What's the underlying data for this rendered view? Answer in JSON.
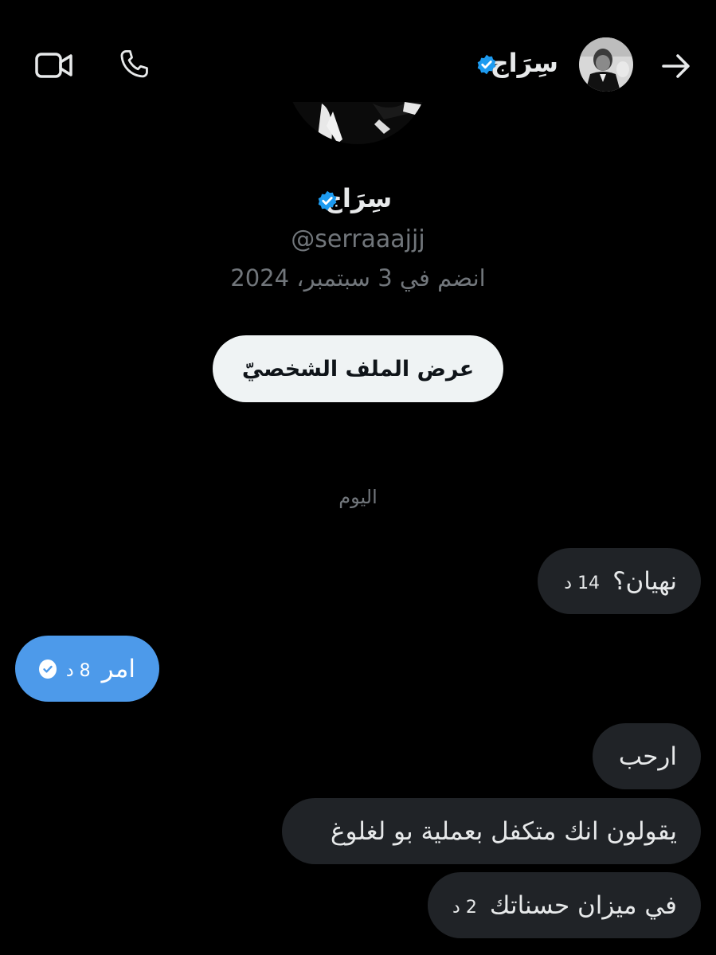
{
  "header": {
    "name": "سِرَاج",
    "back_icon": "arrow-right-icon",
    "call_icon": "phone-icon",
    "video_icon": "video-icon"
  },
  "profile": {
    "name": "سِرَاج",
    "handle": "@serraaajjj",
    "joined": "انضم في 3 سبتمبر، 2024",
    "view_profile_label": "عرض الملف الشخصيّ"
  },
  "day_separator": "اليوم",
  "messages": [
    {
      "text": "نهيان؟",
      "time": "14 د",
      "from": "received"
    },
    {
      "text": "امر",
      "time": "8 د",
      "from": "sent"
    },
    {
      "text": "ارحب",
      "time": "",
      "from": "received"
    },
    {
      "text": "يقولون انك متكفل بعملية بو لغلوغ",
      "time": "",
      "from": "received"
    },
    {
      "text": "في ميزان حسناتك",
      "time": "2 د",
      "from": "received"
    }
  ],
  "colors": {
    "background": "#000000",
    "bubble_received": "#202327",
    "bubble_sent": "#4d9aea",
    "verified": "#1d9bf0",
    "muted_text": "#71767b"
  }
}
